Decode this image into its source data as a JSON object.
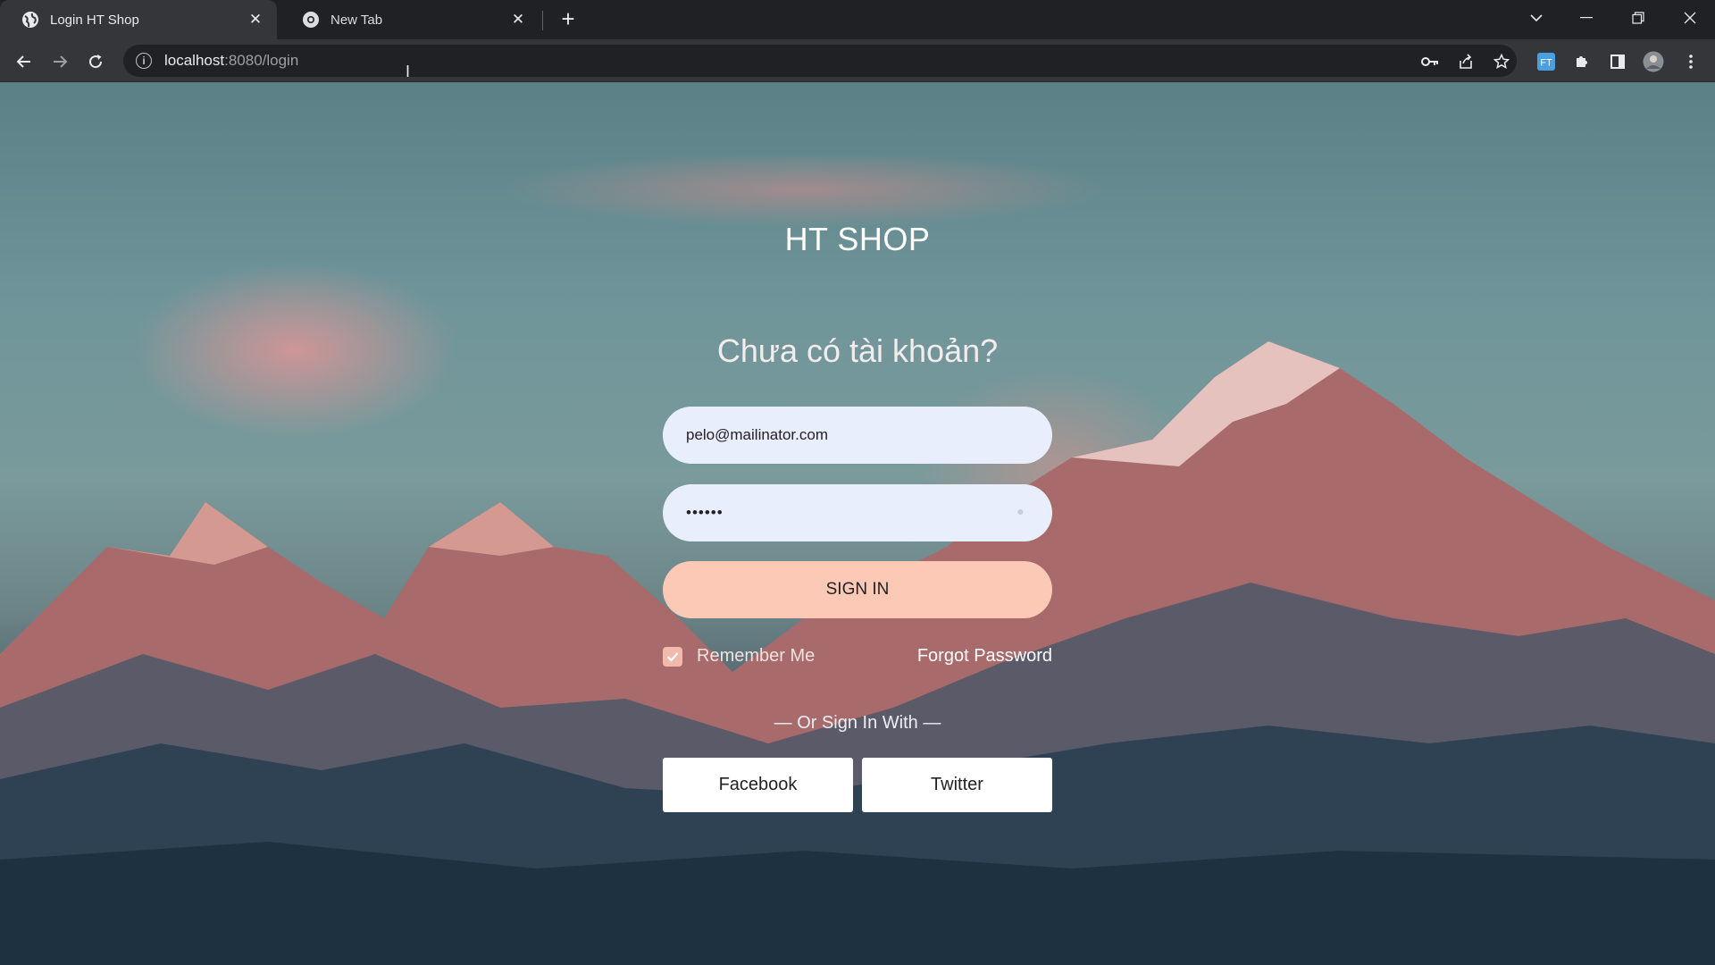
{
  "browser": {
    "tabs": [
      {
        "title": "Login HT Shop",
        "active": true
      },
      {
        "title": "New Tab",
        "active": false
      }
    ],
    "new_tab_label": "+",
    "url_host": "localhost",
    "url_rest": ":8080/login"
  },
  "page": {
    "brand": "HT SHOP",
    "question": "Chưa có tài khoản?",
    "email_value": "pelo@mailinator.com",
    "password_mask": "••••••",
    "signin_label": "SIGN IN",
    "remember_label": "Remember Me",
    "remember_checked": true,
    "forgot_label": "Forgot Password",
    "divider_text": "— Or Sign In With —",
    "facebook_label": "Facebook",
    "twitter_label": "Twitter"
  },
  "colors": {
    "accent_button": "#fbc9b6",
    "checkbox": "#f2b9ad",
    "input_bg": "#e9eefc"
  }
}
